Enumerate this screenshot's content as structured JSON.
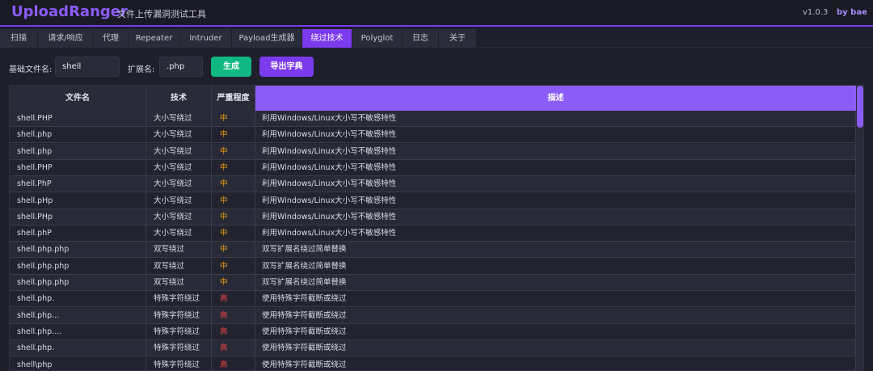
{
  "app": {
    "name": "UploadRanger",
    "subtitle": "文件上传漏洞测试工具",
    "version": "v1.0.3",
    "author": "by bae"
  },
  "tabs": [
    {
      "label": "扫描",
      "active": false
    },
    {
      "label": "请求/响应",
      "active": false
    },
    {
      "label": "代理",
      "active": false
    },
    {
      "label": "Repeater",
      "active": false
    },
    {
      "label": "Intruder",
      "active": false
    },
    {
      "label": "Payload生成器",
      "active": false
    },
    {
      "label": "绕过技术",
      "active": true
    },
    {
      "label": "Polyglot",
      "active": false
    },
    {
      "label": "日志",
      "active": false
    },
    {
      "label": "关于",
      "active": false
    }
  ],
  "toolbar": {
    "base_label": "基础文件名:",
    "base_value": "shell",
    "ext_label": "扩展名:",
    "ext_value": ".php",
    "generate_label": "生成",
    "export_label": "导出字典"
  },
  "table": {
    "headers": [
      "文件名",
      "技术",
      "严重程度",
      "描述"
    ],
    "rows": [
      [
        "shell.PHP",
        "大小写绕过",
        "中",
        "利用Windows/Linux大小写不敏感特性"
      ],
      [
        "shell.php",
        "大小写绕过",
        "中",
        "利用Windows/Linux大小写不敏感特性"
      ],
      [
        "shell.php",
        "大小写绕过",
        "中",
        "利用Windows/Linux大小写不敏感特性"
      ],
      [
        "shell.PHP",
        "大小写绕过",
        "中",
        "利用Windows/Linux大小写不敏感特性"
      ],
      [
        "shell.PhP",
        "大小写绕过",
        "中",
        "利用Windows/Linux大小写不敏感特性"
      ],
      [
        "shell.pHp",
        "大小写绕过",
        "中",
        "利用Windows/Linux大小写不敏感特性"
      ],
      [
        "shell.PHp",
        "大小写绕过",
        "中",
        "利用Windows/Linux大小写不敏感特性"
      ],
      [
        "shell.phP",
        "大小写绕过",
        "中",
        "利用Windows/Linux大小写不敏感特性"
      ],
      [
        "shell.php.php",
        "双写绕过",
        "中",
        "双写扩展名绕过简单替换"
      ],
      [
        "shell.php.php",
        "双写绕过",
        "中",
        "双写扩展名绕过简单替换"
      ],
      [
        "shell.php.php",
        "双写绕过",
        "中",
        "双写扩展名绕过简单替换"
      ],
      [
        "shell.php.",
        "特殊字符绕过",
        "高",
        "使用特殊字符截断或绕过"
      ],
      [
        "shell.php...",
        "特殊字符绕过",
        "高",
        "使用特殊字符截断或绕过"
      ],
      [
        "shell.php....",
        "特殊字符绕过",
        "高",
        "使用特殊字符截断或绕过"
      ],
      [
        "shell.php.",
        "特殊字符绕过",
        "高",
        "使用特殊字符截断或绕过"
      ],
      [
        "shell\\php",
        "特殊字符绕过",
        "高",
        "使用特殊字符截断或绕过"
      ]
    ],
    "severity_colors": {
      "中": "#f59e0b",
      "高": "#ef4444"
    }
  },
  "colors": {
    "accent": "#7c3aed",
    "accent_light": "#8b5cf6",
    "generate_button": "#10b981",
    "background": "#1e1f2b"
  }
}
